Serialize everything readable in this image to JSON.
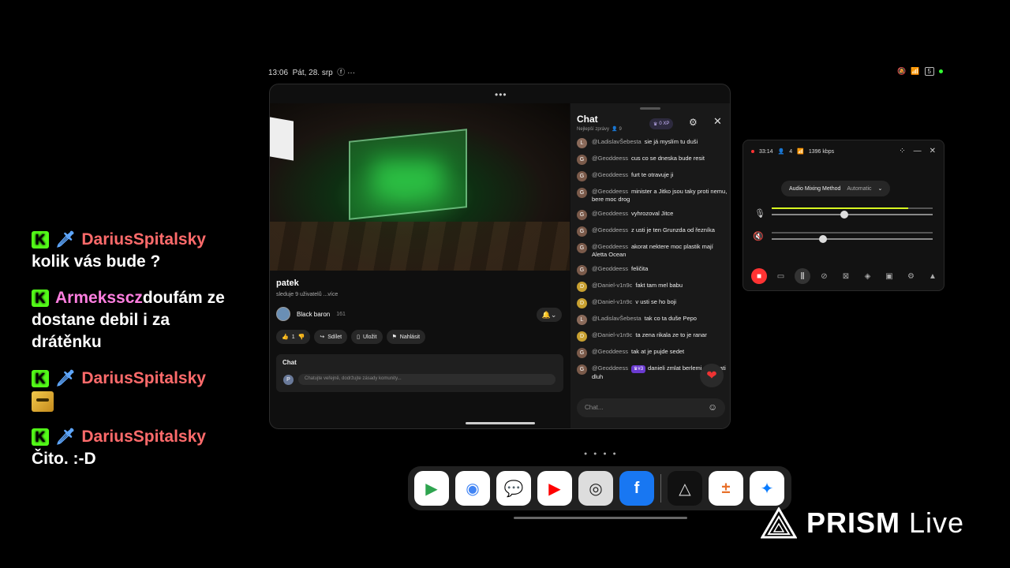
{
  "overlay_chat": [
    {
      "user": "DariusSpitalsky",
      "text": "kolik vás bude ?",
      "color": "#ff6b6b",
      "sword": true,
      "emote": false
    },
    {
      "user": "Armeksscz",
      "text": "doufám ze dostane debil i za drátěnku",
      "color": "#ff7fe0",
      "sword": false,
      "emote": false
    },
    {
      "user": "DariusSpitalsky",
      "text": "",
      "color": "#ff6b6b",
      "sword": true,
      "emote": true
    },
    {
      "user": "DariusSpitalsky",
      "text": "Čito. :-D",
      "color": "#ff6b6b",
      "sword": true,
      "emote": false
    }
  ],
  "statusbar": {
    "time": "13:06",
    "date": "Pát, 28. srp",
    "extra": "ⓕ ···",
    "battery": "5"
  },
  "video": {
    "title": "patek",
    "views": "sleduje 9 uživatelů",
    "more": "...více"
  },
  "channel": {
    "name": "Black baron",
    "subs": "161"
  },
  "actions": {
    "likes": "1",
    "share": "Sdílet",
    "save": "Uložit",
    "report": "Nahlásit"
  },
  "mini_chat": {
    "title": "Chat",
    "avatar": "P",
    "placeholder": "Chatujte veřejně, dodržujte zásady komunity..."
  },
  "chat": {
    "title": "Chat",
    "subtitle": "Nejlepší zprávy",
    "viewers": "9",
    "xp": "0 XP",
    "input_placeholder": "Chat...",
    "messages": [
      {
        "avatar": "L",
        "kind": "l",
        "author": "@LadislavŠebesta",
        "text": "sie já myslím tu duši"
      },
      {
        "avatar": "G",
        "kind": "g",
        "author": "@Geoddeess",
        "text": "cus co se dneska bude resit"
      },
      {
        "avatar": "G",
        "kind": "g",
        "author": "@Geoddeess",
        "text": "furt te otravuje ji"
      },
      {
        "avatar": "G",
        "kind": "g",
        "author": "@Geoddeess",
        "text": "minister a Jitko jsou taky proti nemu, bere moc drog"
      },
      {
        "avatar": "G",
        "kind": "g",
        "author": "@Geoddeess",
        "text": "vyhrozoval Jitce"
      },
      {
        "avatar": "G",
        "kind": "g",
        "author": "@Geoddeess",
        "text": "z usti je ten Grunzda od řezníka"
      },
      {
        "avatar": "G",
        "kind": "g",
        "author": "@Geoddeess",
        "text": "akorat nektere moc plastik mají Aletta Ocean"
      },
      {
        "avatar": "G",
        "kind": "g",
        "author": "@Geoddeess",
        "text": "feličita"
      },
      {
        "avatar": "D",
        "kind": "d",
        "author": "@Daniel-v1n9c",
        "text": "fakt tam mel babu"
      },
      {
        "avatar": "D",
        "kind": "d",
        "author": "@Daniel-v1n9c",
        "text": "v usti se ho boji"
      },
      {
        "avatar": "L",
        "kind": "l",
        "author": "@LadislavŠebesta",
        "text": "tak co ta duše Pepo"
      },
      {
        "avatar": "D",
        "kind": "d",
        "author": "@Daniel-v1n9c",
        "text": "ta zena rikala ze to je ranar"
      },
      {
        "avatar": "G",
        "kind": "g",
        "author": "@Geoddeess",
        "text": "tak at je pujde sedet"
      },
      {
        "avatar": "G",
        "kind": "g",
        "author": "@Geoddeess",
        "badge": "#3",
        "text": "danieli zmlat berlemi at ti vrati dluh"
      }
    ]
  },
  "prism_panel": {
    "timer": "33:14",
    "viewers": "4",
    "bitrate": "1396 kbps",
    "mix_label": "Audio Mixing Method",
    "mix_value": "Automatic",
    "mic_level": 0.85,
    "mic_volume": 0.45,
    "speaker_volume": 0.32
  },
  "dock": {
    "apps": [
      {
        "name": "play-store",
        "glyph": "▶",
        "bg": "#ffffff",
        "fg": "#2ea44f"
      },
      {
        "name": "chrome",
        "glyph": "◉",
        "bg": "#ffffff",
        "fg": "#4285f4"
      },
      {
        "name": "messages",
        "glyph": "💬",
        "bg": "#ffffff",
        "fg": "#1a73e8"
      },
      {
        "name": "youtube",
        "glyph": "▶",
        "bg": "#ffffff",
        "fg": "#ff0000"
      },
      {
        "name": "camera",
        "glyph": "◎",
        "bg": "#dddddd",
        "fg": "#222222"
      },
      {
        "name": "facebook",
        "glyph": "f",
        "bg": "#1877f2",
        "fg": "#ffffff"
      },
      {
        "name": "prism",
        "glyph": "△",
        "bg": "#111111",
        "fg": "#dddddd"
      },
      {
        "name": "calculator",
        "glyph": "±",
        "bg": "#ffffff",
        "fg": "#e8702a"
      },
      {
        "name": "messenger",
        "glyph": "✦",
        "bg": "#ffffff",
        "fg": "#0a7cff"
      }
    ]
  },
  "logo": {
    "bold": "PRISM",
    "light": "Live"
  }
}
